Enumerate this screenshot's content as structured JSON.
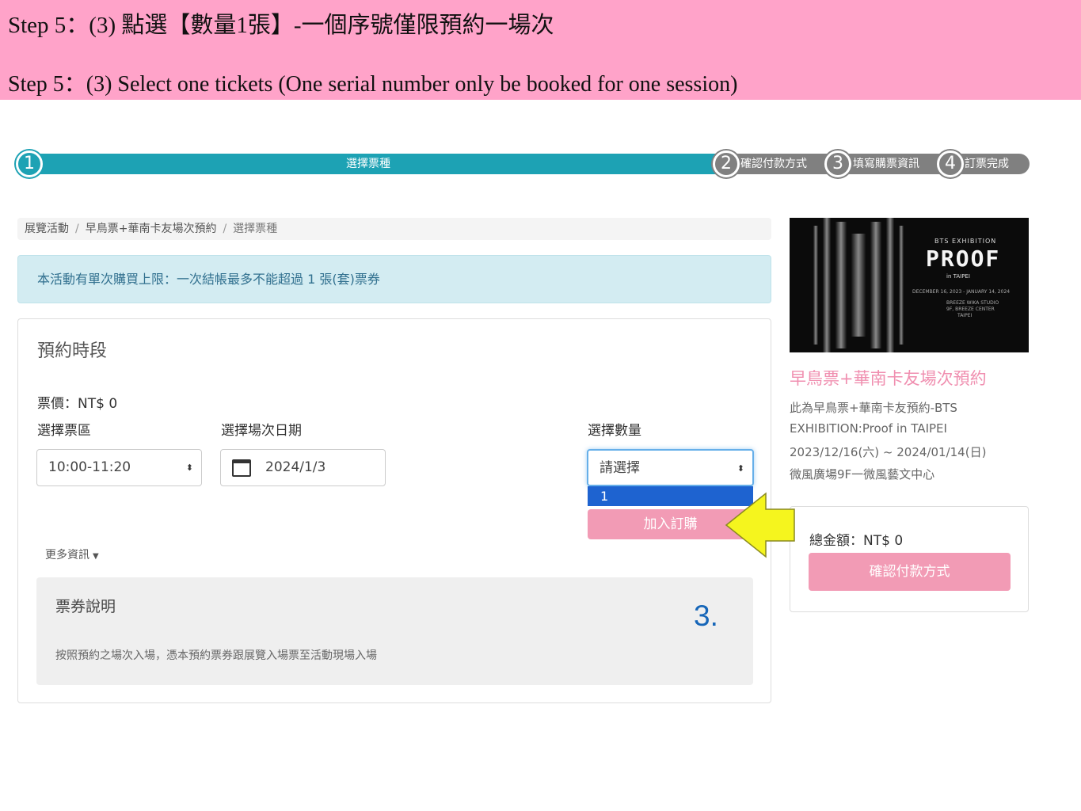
{
  "banner": {
    "line1": "Step 5：(3) 點選【數量1張】-一個序號僅限預約一場次",
    "line2": "Step 5：(3) Select one tickets (One serial number  only be booked for one session)"
  },
  "progress": {
    "current_step": "1",
    "step1_label": "選擇票種",
    "step2_num": "2",
    "step2_label": "確認付款方式",
    "step3_num": "3",
    "step3_label": "填寫購票資訊",
    "step4_num": "4",
    "step4_label": "訂票完成"
  },
  "breadcrumb": {
    "item1": "展覽活動",
    "item2": "早鳥票+華南卡友場次預約",
    "current": "選擇票種",
    "separator": "/"
  },
  "alert_text": "本活動有單次購買上限：一次結帳最多不能超過  1  張(套)票券",
  "booking": {
    "title": "預約時段",
    "price": "票價：NT$  0",
    "zone_label": "選擇票區",
    "zone_value": "10:00-11:20",
    "date_label": "選擇場次日期",
    "date_value": "2024/1/3",
    "qty_label": "選擇數量",
    "qty_placeholder": "請選擇",
    "qty_option": "1",
    "add_button": "加入訂購",
    "more_info": "更多資訊"
  },
  "ticket_desc": {
    "title": "票券說明",
    "body": "按照預約之場次入場，憑本預約票券跟展覽入場票至活動現場入場",
    "annotation": "3."
  },
  "poster": {
    "small_title": "BTS EXHIBITION",
    "title": "PROOF",
    "sub": "in TAIPEI",
    "dates": "DECEMBER 16, 2023 - JANUARY 14, 2024",
    "venue1": "BREEZE WIKA STUDIO",
    "venue2": "9F, BREEZE CENTER",
    "venue3": "TAIPEI"
  },
  "event": {
    "title": "早鳥票+華南卡友場次預約",
    "desc1": "此為早鳥票+華南卡友預約-BTS",
    "desc2": "EXHIBITION:Proof  in  TAIPEI",
    "desc3": "2023/12/16(六)  ~  2024/01/14(日)",
    "desc4": "微風廣場9F一微風藝文中心"
  },
  "summary": {
    "total": "總金額：NT$  0",
    "confirm_button": "確認付款方式"
  },
  "colors": {
    "banner_bg": "#ffa3c9",
    "progress_active": "#1da2b4",
    "progress_inactive": "#808080",
    "button_pink": "#f29bb5",
    "alert_bg": "#d3ecf2",
    "arrow_yellow": "#f5f51e",
    "annotation_blue": "#1666b8"
  },
  "icons": {
    "calendar": "calendar-icon",
    "select_caret": "select-updown-icon",
    "dropdown_caret": "caret-down-icon",
    "pointer": "yellow-arrow-icon"
  }
}
